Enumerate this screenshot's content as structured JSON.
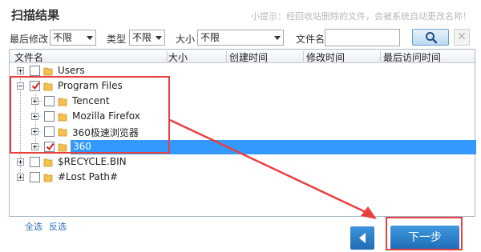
{
  "title": "扫描结果",
  "tip": "小提示：经回收站删除的文件，会被系统自动更改名称！",
  "filters": {
    "last_modified_label": "最后修改",
    "last_modified_value": "不限",
    "type_label": "类型",
    "type_value": "不限",
    "size_label": "大小",
    "size_value": "不限",
    "filename_label": "文件名",
    "filename_value": ""
  },
  "columns": [
    "文件名",
    "大小",
    "创建时间",
    "修改时间",
    "最后访问时间"
  ],
  "tree": [
    {
      "label": "Users",
      "checked": false,
      "expander": "plus"
    },
    {
      "label": "Program Files",
      "checked": true,
      "expander": "minus"
    },
    {
      "label": "Tencent",
      "checked": false,
      "expander": "plus"
    },
    {
      "label": "Mozilla Firefox",
      "checked": false,
      "expander": "plus"
    },
    {
      "label": "360极速浏览器",
      "checked": false,
      "expander": "plus"
    },
    {
      "label": "360",
      "checked": true,
      "expander": "plus",
      "selected": true
    },
    {
      "label": "$RECYCLE.BIN",
      "checked": false,
      "expander": "plus"
    },
    {
      "label": "#Lost Path#",
      "checked": false,
      "expander": "plus"
    }
  ],
  "select_all": "全选",
  "invert_select": "反选",
  "next_button": "下一步",
  "colors": {
    "accent": "#1e6cb5",
    "selection": "#3399ff",
    "highlight": "#e8403e",
    "folder": "#f2c14e"
  }
}
